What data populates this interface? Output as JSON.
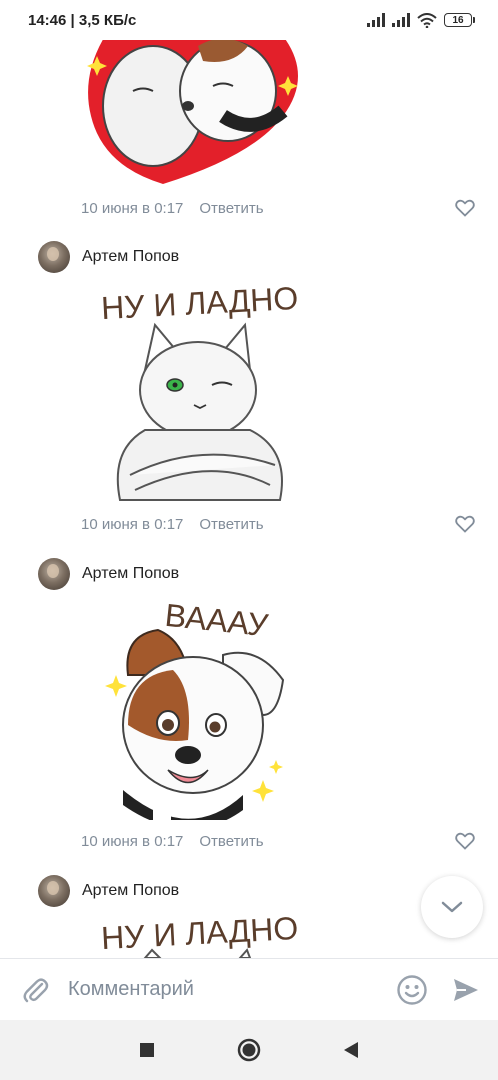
{
  "status_bar": {
    "time_speed": "14:46 | 3,5 КБ/с",
    "battery": "16"
  },
  "comments": [
    {
      "meta_time": "10 июня в 0:17",
      "reply": "Ответить"
    },
    {
      "author": "Артем Попов",
      "sticker_text": "НУ И ЛАДНО",
      "meta_time": "10 июня в 0:17",
      "reply": "Ответить"
    },
    {
      "author": "Артем Попов",
      "sticker_text": "ВАААУ",
      "meta_time": "10 июня в 0:17",
      "reply": "Ответить"
    },
    {
      "author": "Артем Попов",
      "sticker_text": "НУ И ЛАДНО"
    }
  ],
  "composer": {
    "placeholder": "Комментарий"
  },
  "colors": {
    "accent": "#5181b8",
    "meta": "#818c99",
    "heart_red": "#e3202a"
  },
  "icons": [
    "attach-icon",
    "emoji-icon",
    "send-icon",
    "heart-icon",
    "chevron-down-icon",
    "square-nav-icon",
    "circle-nav-icon",
    "back-nav-icon"
  ]
}
